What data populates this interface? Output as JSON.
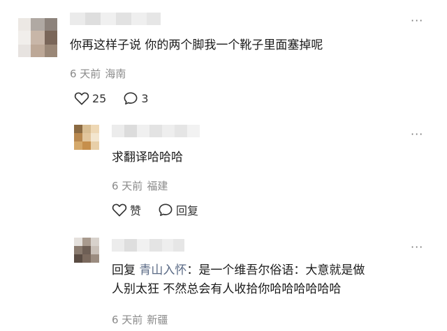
{
  "comments": [
    {
      "text": "你再这样子说 你的两个脚我一个靴子里面塞掉呢",
      "time": "6 天前",
      "location": "海南",
      "like_count": "25",
      "reply_count": "3",
      "more_label": "···"
    },
    {
      "text": "求翻译哈哈哈",
      "time": "6 天前",
      "location": "福建",
      "like_label": "赞",
      "reply_label": "回复",
      "more_label": "···"
    },
    {
      "reply_prefix": "回复",
      "reply_target": "青山入怀",
      "line1": "：是一个维吾尔俗语：大意就是做",
      "line2": "人别太狂 不然总会有人收拾你哈哈哈哈哈哈",
      "time": "6 天前",
      "location": "新疆",
      "more_label": "···"
    }
  ],
  "icons": {
    "like": "heart-outline-icon",
    "comment": "speech-bubble-icon",
    "more": "more-dots-icon"
  },
  "colors": {
    "meta": "#8a8a8a",
    "reply_target": "#5a6a85"
  }
}
